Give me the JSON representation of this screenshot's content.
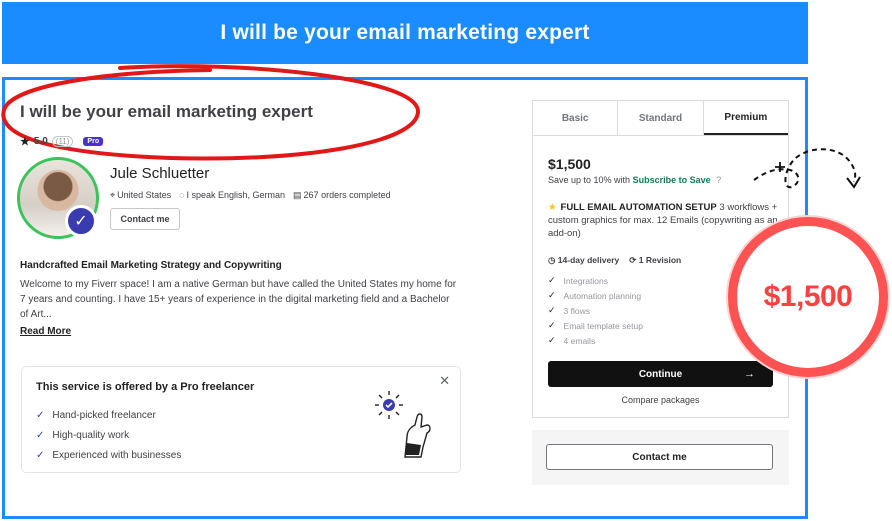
{
  "banner": {
    "title": "I will be your email marketing expert"
  },
  "gig": {
    "title": "I will be your email marketing expert",
    "rating": "5.0",
    "rating_count": "(11)",
    "pro_label": "Pro"
  },
  "seller": {
    "name": "Jule Schluetter",
    "country": "United States",
    "languages": "I speak English, German",
    "orders": "267 orders completed",
    "contact_label": "Contact me"
  },
  "description": {
    "heading": "Handcrafted Email Marketing Strategy and Copywriting",
    "body": "Welcome to my Fiverr space! I am a native German but have called the United States my home for 7 years and counting. I have 15+ years of experience in the digital marketing field and a Bachelor of Art...",
    "read_more": "Read More"
  },
  "pro_card": {
    "title": "This service is offered by a Pro freelancer",
    "items": [
      "Hand-picked freelancer",
      "High-quality work",
      "Experienced with businesses"
    ]
  },
  "package": {
    "tabs": [
      "Basic",
      "Standard",
      "Premium"
    ],
    "active_tab": "Premium",
    "price": "$1,500",
    "save_prefix": "Save up to 10% with",
    "save_link": "Subscribe to Save",
    "title_bold": "FULL EMAIL AUTOMATION SETUP",
    "title_rest": "3 workflows + custom graphics for max. 12 Emails (copywriting as an add-on)",
    "delivery": "14-day delivery",
    "revisions": "1 Revision",
    "features": [
      "Integrations",
      "Automation planning",
      "3 flows",
      "Email template setup",
      "4 emails"
    ],
    "continue_label": "Continue",
    "compare_label": "Compare packages"
  },
  "contact_box": {
    "label": "Contact me"
  },
  "callout": {
    "price": "$1,500"
  },
  "colors": {
    "accent_blue": "#1b8cff",
    "highlight_red": "#ff5252",
    "pro_purple": "#4a2fd8"
  }
}
